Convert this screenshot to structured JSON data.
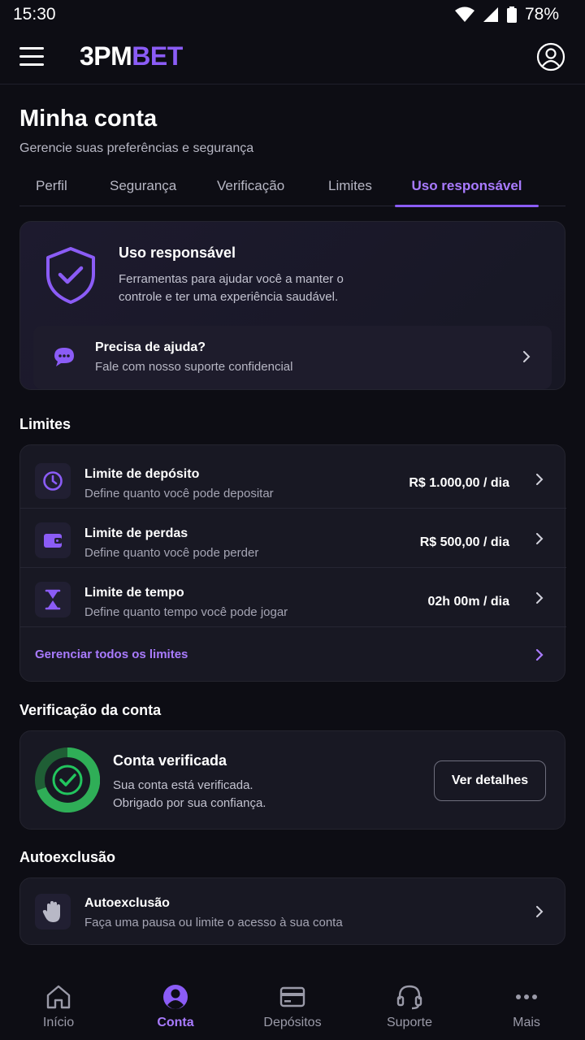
{
  "status_bar": {
    "time": "15:30",
    "battery": "78%"
  },
  "header": {
    "brand_part1": "3PM",
    "brand_part2": "BET",
    "brand_color": "#8b5cf6"
  },
  "page": {
    "title": "Minha conta",
    "subtitle": "Gerencie suas preferências e segurança"
  },
  "tabs": [
    {
      "label": "Perfil",
      "active": false
    },
    {
      "label": "Segurança",
      "active": false
    },
    {
      "label": "Verificação",
      "active": false
    },
    {
      "label": "Limites",
      "active": false
    },
    {
      "label": "Uso responsável",
      "active": true
    }
  ],
  "hero": {
    "icon": "shield-check-icon",
    "title": "Uso responsável",
    "description": "Ferramentas para ajudar você a manter o controle e ter uma experiência saudável.",
    "help": {
      "icon": "chat-bubble-icon",
      "title": "Precisa de ajuda?",
      "subtitle": "Fale com nosso suporte confidencial"
    }
  },
  "limits": {
    "section_title": "Limites",
    "items": [
      {
        "icon": "clock-icon",
        "title": "Limite de depósito",
        "subtitle": "Define quanto você pode depositar",
        "value": "R$ 1.000,00 / dia"
      },
      {
        "icon": "wallet-icon",
        "title": "Limite de perdas",
        "subtitle": "Define quanto você pode perder",
        "value": "R$ 500,00 / dia"
      },
      {
        "icon": "hourglass-icon",
        "title": "Limite de tempo",
        "subtitle": "Define quanto tempo você pode jogar",
        "value": "02h 00m / dia"
      }
    ],
    "manage_label": "Gerenciar todos os limites"
  },
  "verification": {
    "section_title": "Verificação da conta",
    "title": "Conta verificada",
    "line1": "Sua conta está verificada.",
    "line2": "Obrigado por sua confiança.",
    "button_label": "Ver detalhes",
    "status_color": "#22c55e"
  },
  "self_exclusion": {
    "section_title": "Autoexclusão",
    "icon": "hand-stop-icon",
    "title": "Autoexclusão",
    "subtitle": "Faça uma pausa ou limite o acesso à sua conta"
  },
  "bottom_nav": [
    {
      "icon": "home-icon",
      "label": "Início",
      "active": false
    },
    {
      "icon": "user-circle-icon",
      "label": "Conta",
      "active": true
    },
    {
      "icon": "card-icon",
      "label": "Depósitos",
      "active": false
    },
    {
      "icon": "headset-icon",
      "label": "Suporte",
      "active": false
    },
    {
      "icon": "more-icon",
      "label": "Mais",
      "active": false
    }
  ]
}
